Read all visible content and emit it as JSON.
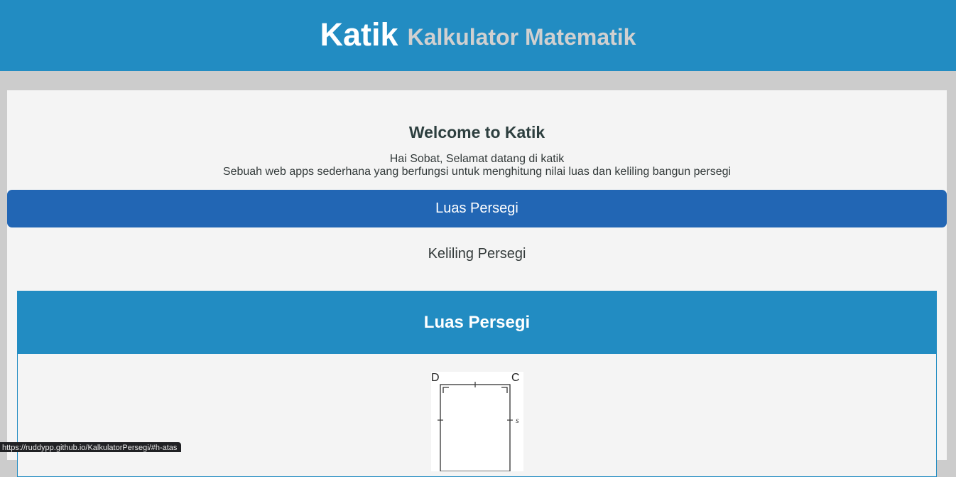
{
  "header": {
    "brand": "Katik",
    "subtitle": "Kalkulator Matematik"
  },
  "welcome": {
    "title": "Welcome to Katik",
    "line1": "Hai Sobat, Selamat datang di katik",
    "line2": "Sebuah web apps sederhana yang berfungsi untuk menghitung nilai luas dan keliling bangun persegi"
  },
  "tabs": [
    {
      "label": "Luas Persegi",
      "active": true
    },
    {
      "label": "Keliling Persegi",
      "active": false
    }
  ],
  "card": {
    "title": "Luas Persegi",
    "figure": {
      "vertex_d": "D",
      "vertex_c": "C",
      "side_label": "s"
    }
  },
  "status_bar": {
    "url": "https://ruddypp.github.io/KalkulatorPersegi/#h-atas"
  },
  "colors": {
    "header_bg": "#228cc2",
    "active_tab": "#2266b4",
    "page_bg": "#cccccc",
    "content_bg": "#f4f4f4"
  }
}
